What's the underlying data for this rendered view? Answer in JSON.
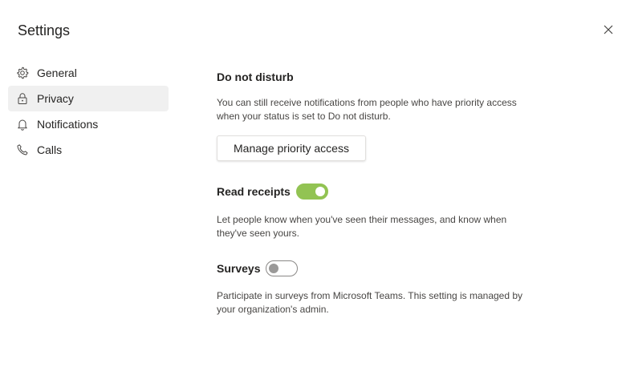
{
  "header": {
    "title": "Settings",
    "close_icon": "close-icon"
  },
  "sidebar": {
    "items": [
      {
        "label": "General",
        "icon": "gear-icon",
        "active": false
      },
      {
        "label": "Privacy",
        "icon": "lock-icon",
        "active": true
      },
      {
        "label": "Notifications",
        "icon": "bell-icon",
        "active": false
      },
      {
        "label": "Calls",
        "icon": "phone-icon",
        "active": false
      }
    ]
  },
  "main": {
    "do_not_disturb": {
      "title": "Do not disturb",
      "description": "You can still receive notifications from people who have priority access when your status is set to Do not disturb.",
      "button_label": "Manage priority access"
    },
    "read_receipts": {
      "title": "Read receipts",
      "enabled": true,
      "description": "Let people know when you've seen their messages, and know when they've seen yours."
    },
    "surveys": {
      "title": "Surveys",
      "enabled": false,
      "description": "Participate in surveys from Microsoft Teams. This setting is managed by your organization's admin."
    }
  },
  "colors": {
    "toggle_on": "#92c353",
    "active_nav_background": "#f0f0f0",
    "text": "#252423"
  }
}
